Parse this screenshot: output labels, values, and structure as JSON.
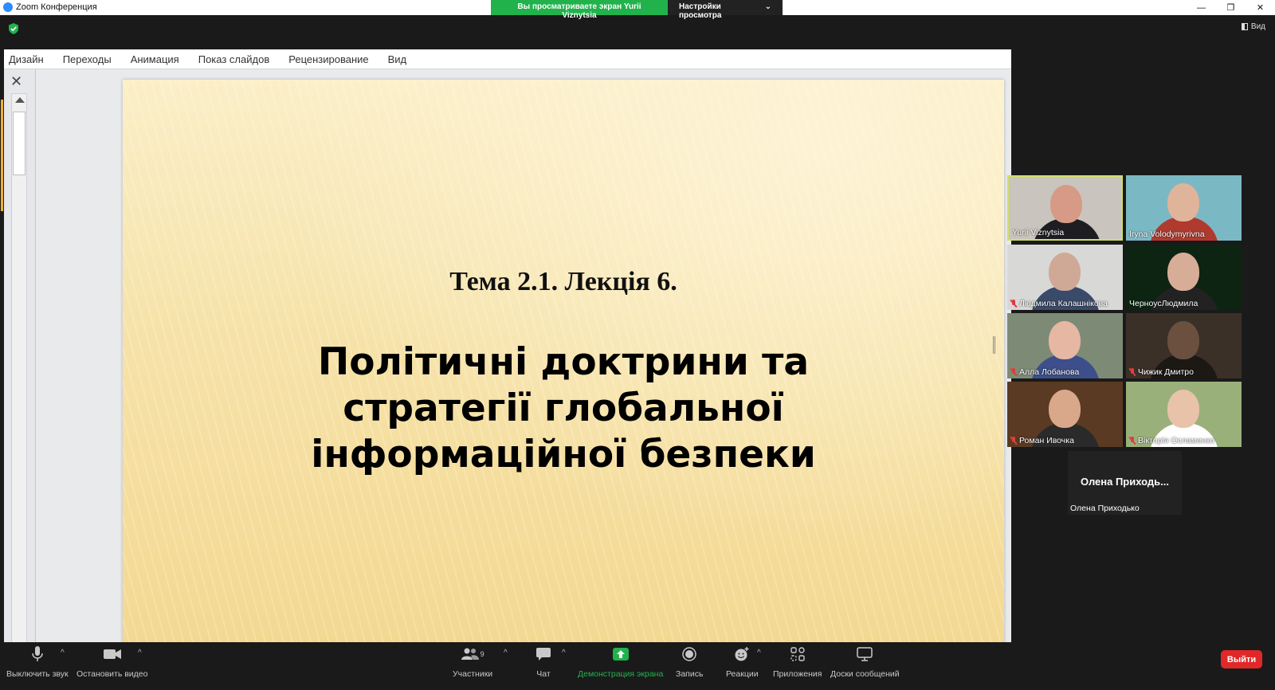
{
  "window": {
    "title": "Zoom Конференция",
    "controls": [
      "—",
      "❐",
      "✕"
    ]
  },
  "share_banner": {
    "viewing": "Вы просматриваете экран Yurii Viznytsia",
    "settings": "Настройки просмотра",
    "chevron": "⌄"
  },
  "view_button": "Вид",
  "ppt": {
    "tabs": [
      "Дизайн",
      "Переходы",
      "Анимация",
      "Показ слайдов",
      "Рецензирование",
      "Вид"
    ],
    "slide_topic": "Тема 2.1. Лекція 6.",
    "slide_title_lines": [
      "Політичні доктрини та",
      "стратегії глобальної",
      "інформаційної безпеки"
    ]
  },
  "participants": [
    {
      "name": "Yurii Viznytsia",
      "muted": false,
      "active": true,
      "bg": "#c9c4bd",
      "skin": "#d79a86",
      "shirt": "#1e1e22"
    },
    {
      "name": "Iryna Volodymyrivna",
      "muted": false,
      "active": false,
      "bg": "#7ab8c4",
      "skin": "#e0b49a",
      "shirt": "#b03a2e"
    },
    {
      "name": "Людмила Калашнікова",
      "muted": true,
      "active": false,
      "bg": "#d8d8d6",
      "skin": "#cfa996",
      "shirt": "#3a4a6a"
    },
    {
      "name": "ЧерноусЛюдмила",
      "muted": false,
      "active": false,
      "bg": "#0d2412",
      "skin": "#d8ad98",
      "shirt": "#222222"
    },
    {
      "name": "Алла Лобанова",
      "muted": true,
      "active": false,
      "bg": "#7d8b76",
      "skin": "#e6b7a2",
      "shirt": "#3c4f8a"
    },
    {
      "name": "Чижик Дмитро",
      "muted": true,
      "active": false,
      "bg": "#3a3028",
      "skin": "#6b5040",
      "shirt": "#1c1814"
    },
    {
      "name": "Роман Ивочка",
      "muted": true,
      "active": false,
      "bg": "#5a3a22",
      "skin": "#d9a88a",
      "shirt": "#2a2a2a"
    },
    {
      "name": "Вікторія Осламенко",
      "muted": true,
      "active": false,
      "bg": "#9ab07a",
      "skin": "#e9c2aa",
      "shirt": "#ffffff"
    }
  ],
  "no_video_participant": {
    "big_name": "Олена  Приходь...",
    "name": "Олена Приходько"
  },
  "toolbar": {
    "mute": "Выключить звук",
    "video": "Остановить видео",
    "participants": "Участники",
    "participants_count": "9",
    "chat": "Чат",
    "share": "Демонстрация экрана",
    "record": "Запись",
    "reactions": "Реакции",
    "apps": "Приложения",
    "whiteboards": "Доски сообщений",
    "leave": "Выйти"
  },
  "colors": {
    "share_green": "#22b24c",
    "leave_red": "#e02828",
    "active_speaker": "#cfe068"
  }
}
